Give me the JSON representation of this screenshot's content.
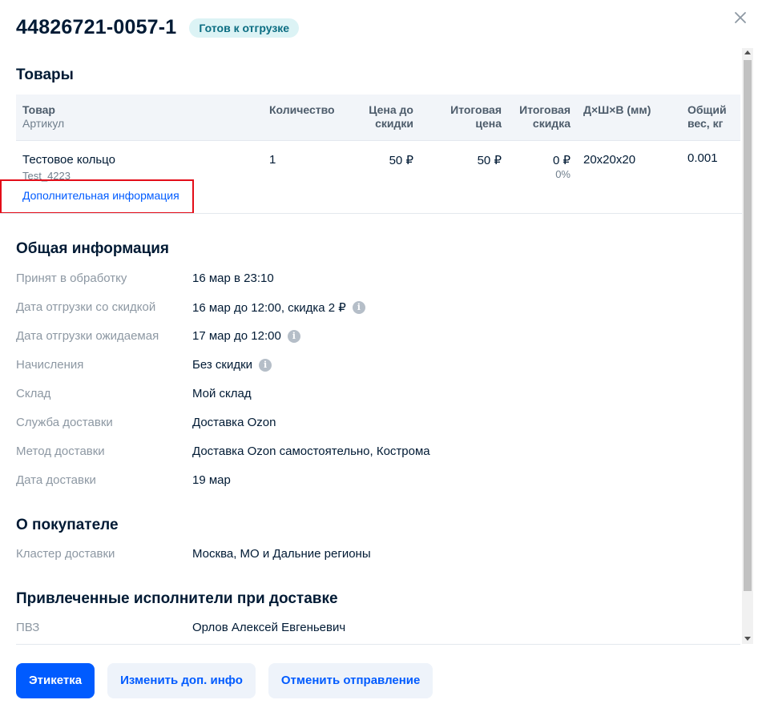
{
  "header": {
    "title": "44826721-0057-1",
    "status_badge": "Готов к отгрузке"
  },
  "goods": {
    "section_title": "Товары",
    "columns": {
      "product": "Товар",
      "article": "Артикул",
      "quantity": "Количество",
      "price_before_line1": "Цена до",
      "price_before_line2": "скидки",
      "final_price_line1": "Итоговая",
      "final_price_line2": "цена",
      "final_discount_line1": "Итоговая",
      "final_discount_line2": "скидка",
      "dimensions": "Д×Ш×В (мм)",
      "weight_line1": "Общий",
      "weight_line2": "вес, кг"
    },
    "row": {
      "name": "Тестовое кольцо",
      "article": "Test_4223",
      "quantity": "1",
      "price_before": "50 ₽",
      "final_price": "50 ₽",
      "discount": "0 ₽",
      "discount_percent": "0%",
      "dimensions": "20x20x20",
      "weight": "0.001"
    },
    "more_info_link": "Дополнительная информация"
  },
  "general": {
    "section_title": "Общая информация",
    "rows": [
      {
        "label": "Принят в обработку",
        "value": "16 мар в 23:10"
      },
      {
        "label": "Дата отгрузки со скидкой",
        "value": "16 мар до 12:00, скидка 2 ₽"
      },
      {
        "label": "Дата отгрузки ожидаемая",
        "value": "17 мар до 12:00"
      },
      {
        "label": "Начисления",
        "value": "Без скидки"
      },
      {
        "label": "Склад",
        "value": "Мой склад"
      },
      {
        "label": "Служба доставки",
        "value": "Доставка Ozon"
      },
      {
        "label": "Метод доставки",
        "value": "Доставка Ozon самостоятельно, Кострома"
      },
      {
        "label": "Дата доставки",
        "value": "19 мар"
      }
    ]
  },
  "buyer": {
    "section_title": "О покупателе",
    "rows": [
      {
        "label": "Кластер доставки",
        "value": "Москва, МО и Дальние регионы"
      }
    ]
  },
  "executors": {
    "section_title": "Привлеченные исполнители при доставке",
    "rows": [
      {
        "label": "ПВЗ",
        "value": "Орлов Алексей Евгеньевич"
      }
    ]
  },
  "footer": {
    "label_button": "Этикетка",
    "edit_info_button": "Изменить доп. инфо",
    "cancel_button": "Отменить отправление"
  },
  "icons": {
    "close": "close-icon",
    "info": "info-icon",
    "info_glyph": "i"
  },
  "colors": {
    "accent": "#005bff",
    "badge_bg": "#dcf3f5",
    "badge_text": "#0b6d82",
    "highlight": "#e30d18"
  }
}
